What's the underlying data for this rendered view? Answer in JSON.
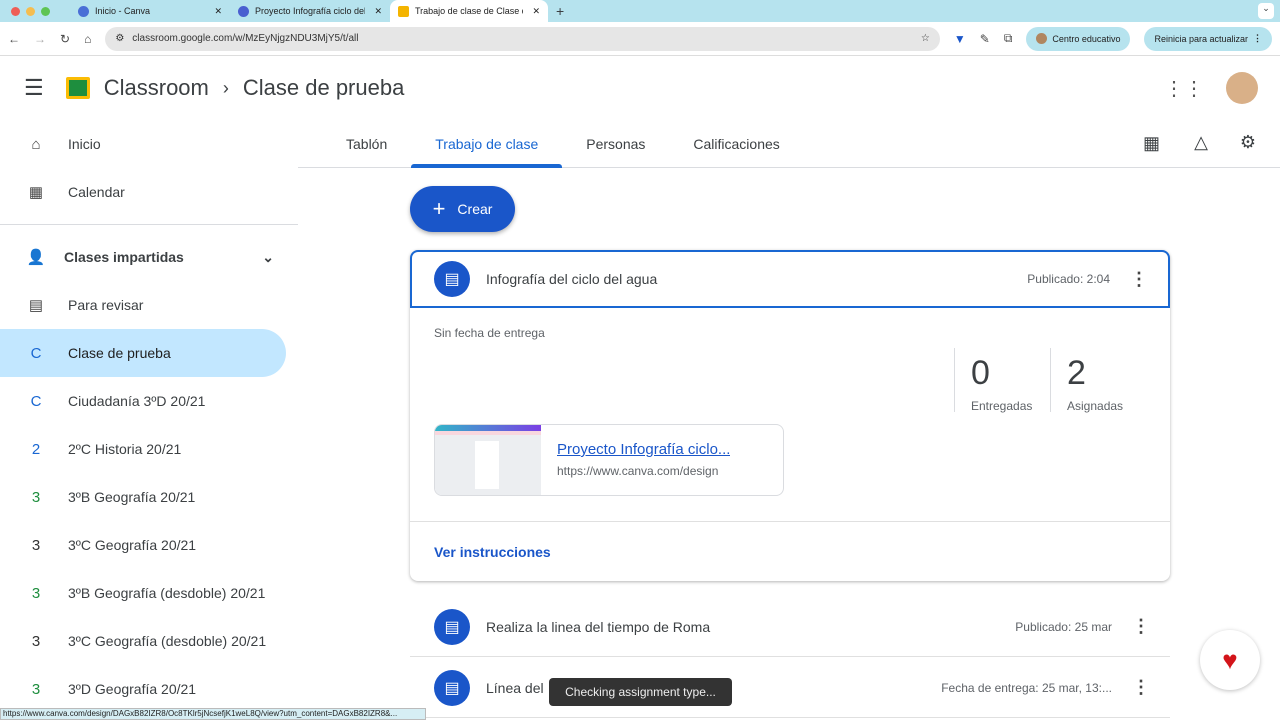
{
  "browser": {
    "tabs": [
      {
        "title": "Inicio - Canva"
      },
      {
        "title": "Proyecto Infografía ciclo del a"
      },
      {
        "title": "Trabajo de clase de Clase de"
      }
    ],
    "url": "classroom.google.com/w/MzEyNjgzNDU3MjY5/t/all",
    "profile": "Centro educativo",
    "update": "Reinicia para actualizar",
    "status_url": "https://www.canva.com/design/DAGxB82IZR8/Oc8TKlr5jNcsefjK1weL8Q/view?utm_content=DAGxB82IZR8&..."
  },
  "header": {
    "app": "Classroom",
    "class": "Clase de prueba"
  },
  "sidebar": {
    "items": [
      {
        "label": "Inicio",
        "icon": "⌂"
      },
      {
        "label": "Calendar",
        "icon": "▦"
      }
    ],
    "section": "Clases impartidas",
    "review": "Para revisar",
    "classes": [
      {
        "l": "C",
        "label": "Clase de prueba"
      },
      {
        "l": "C",
        "label": "Ciudadanía 3ºD 20/21"
      },
      {
        "l": "2",
        "label": "2ºC Historia 20/21"
      },
      {
        "l": "3",
        "label": "3ºB Geografía 20/21"
      },
      {
        "l": "3",
        "label": "3ºC Geografía 20/21"
      },
      {
        "l": "3",
        "label": "3ºB Geografía (desdoble) 20/21"
      },
      {
        "l": "3",
        "label": "3ºC Geografía (desdoble) 20/21"
      },
      {
        "l": "3",
        "label": "3ºD Geografía 20/21"
      }
    ]
  },
  "tabs": [
    "Tablón",
    "Trabajo de clase",
    "Personas",
    "Calificaciones"
  ],
  "create": "Crear",
  "assignment": {
    "title": "Infografía del ciclo del agua",
    "published": "Publicado: 2:04",
    "due": "Sin fecha de entrega",
    "handed_in": "0",
    "handed_in_label": "Entregadas",
    "assigned": "2",
    "assigned_label": "Asignadas",
    "attachment_title": "Proyecto Infografía ciclo...",
    "attachment_url": "https://www.canva.com/design",
    "instructions": "Ver instrucciones"
  },
  "rows": [
    {
      "title": "Realiza la linea del tiempo de Roma",
      "meta": "Publicado: 25 mar"
    },
    {
      "title": "Línea del",
      "meta": "Fecha de entrega: 25 mar, 13:..."
    }
  ],
  "toast": "Checking assignment type..."
}
